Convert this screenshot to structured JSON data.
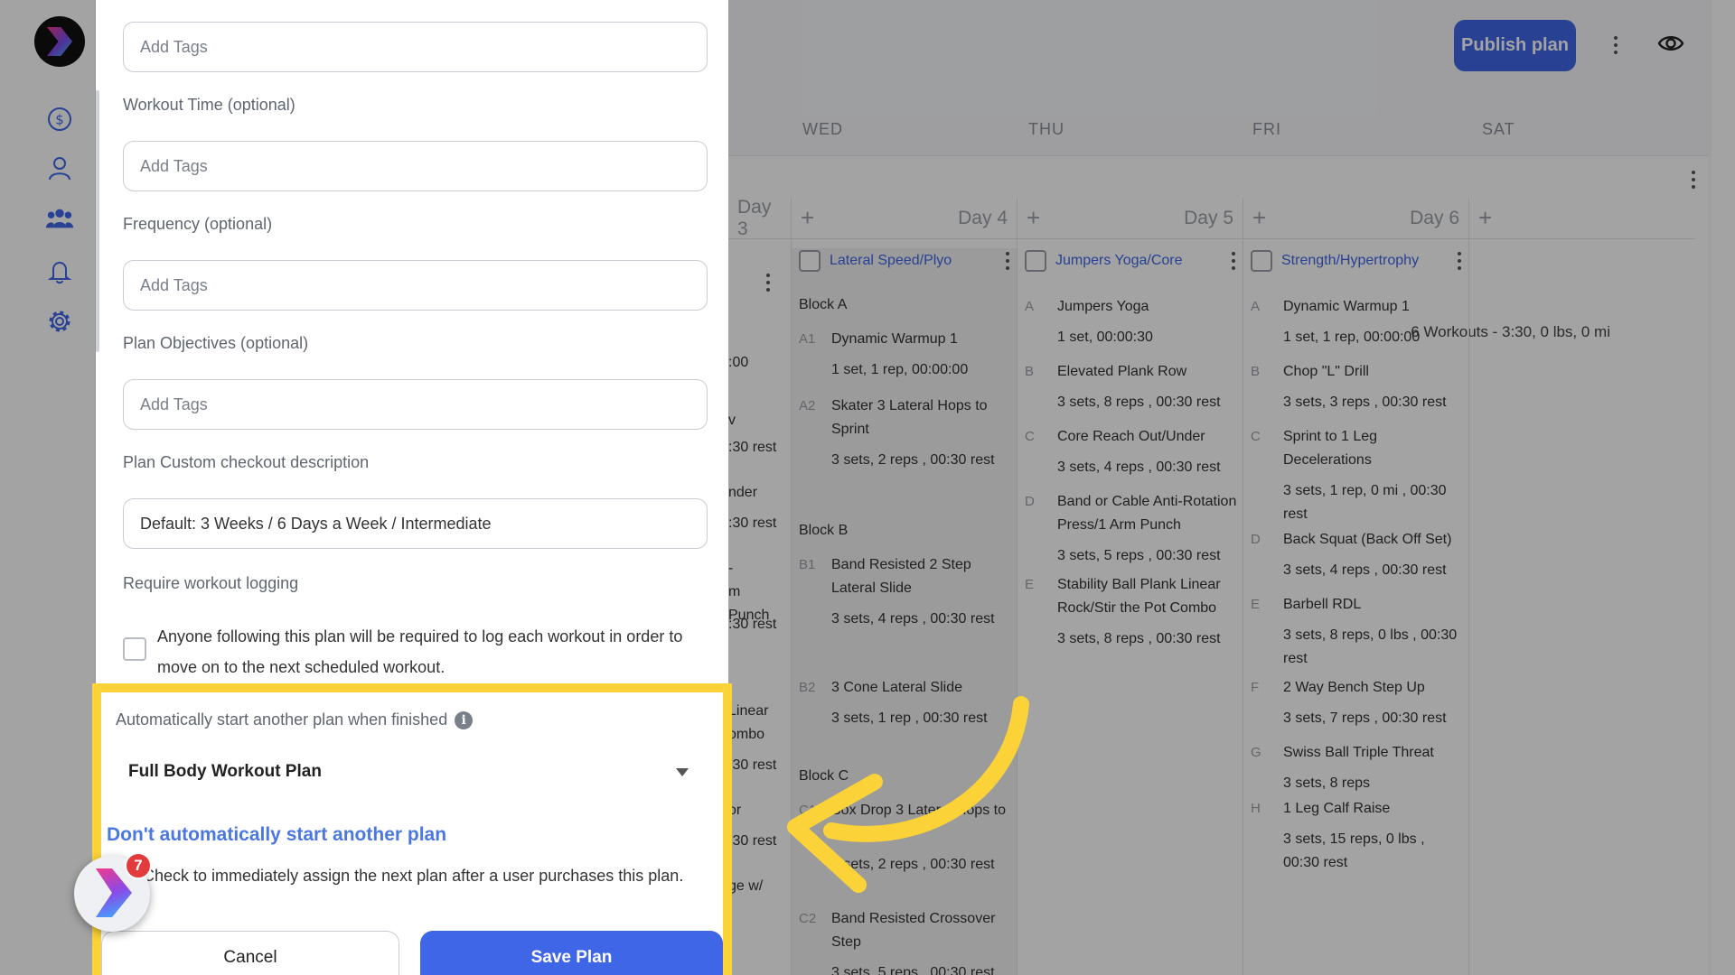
{
  "header": {
    "publish_label": "Publish plan"
  },
  "calendar": {
    "day_names": [
      "WED",
      "THU",
      "FRI",
      "SAT"
    ],
    "summary": "6 Workouts - 3:30, 0 lbs, 0 mi",
    "days": [
      {
        "label": "Day 4",
        "workout": "Lateral Speed/Plyo",
        "items": [
          {
            "type": "block",
            "text": "Block A"
          },
          {
            "code": "A1",
            "name": "Dynamic Warmup 1",
            "detail": "1 set, 1 rep, 00:00:00"
          },
          {
            "code": "A2",
            "name": "Skater 3 Lateral Hops to Sprint",
            "detail": "3 sets, 2 reps , 00:30 rest"
          },
          {
            "type": "block",
            "text": "Block B"
          },
          {
            "code": "B1",
            "name": "Band Resisted 2 Step Lateral Slide",
            "detail": "3 sets, 4 reps , 00:30 rest"
          },
          {
            "code": "B2",
            "name": "3 Cone Lateral Slide",
            "detail": "3 sets, 1 rep , 00:30 rest"
          },
          {
            "type": "block",
            "text": "Block C"
          },
          {
            "code": "C1",
            "name": "Box Drop 3 Lateral Hops to Slide",
            "detail": "3 sets, 2 reps , 00:30 rest"
          },
          {
            "code": "C2",
            "name": "Band Resisted Crossover Step",
            "detail": "3 sets, 5 reps , 00:30 rest"
          }
        ]
      },
      {
        "label": "Day 5",
        "workout": "Jumpers Yoga/Core",
        "items": [
          {
            "code": "A",
            "name": "Jumpers Yoga",
            "detail": "1 set, 00:00:30"
          },
          {
            "code": "B",
            "name": "Elevated Plank Row",
            "detail": "3 sets, 8 reps , 00:30 rest"
          },
          {
            "code": "C",
            "name": "Core Reach Out/Under",
            "detail": "3 sets, 4 reps , 00:30 rest"
          },
          {
            "code": "D",
            "name": "Band or Cable Anti-Rotation Press/1 Arm Punch",
            "detail": "3 sets, 5 reps , 00:30 rest"
          },
          {
            "code": "E",
            "name": "Stability Ball Plank Linear Rock/Stir the Pot Combo",
            "detail": "3 sets, 8 reps , 00:30 rest"
          }
        ]
      },
      {
        "label": "Day 6",
        "workout": "Strength/Hypertrophy",
        "items": [
          {
            "code": "A",
            "name": "Dynamic Warmup 1",
            "detail": "1 set, 1 rep, 00:00:00"
          },
          {
            "code": "B",
            "name": "Chop \"L\" Drill",
            "detail": "3 sets, 3 reps , 00:30 rest"
          },
          {
            "code": "C",
            "name": "Sprint to 1 Leg Decelerations",
            "detail": "3 sets, 1 rep, 0 mi , 00:30 rest"
          },
          {
            "code": "D",
            "name": "Back Squat (Back Off Set)",
            "detail": "3 sets, 4 reps , 00:30 rest"
          },
          {
            "code": "E",
            "name": "Barbell RDL",
            "detail": "3 sets, 8 reps, 0 lbs , 00:30 rest"
          },
          {
            "code": "F",
            "name": "2 Way Bench Step Up",
            "detail": "3 sets, 7 reps , 00:30 rest"
          },
          {
            "code": "G",
            "name": "Swiss Ball Triple Threat",
            "detail": "3 sets, 8 reps"
          },
          {
            "code": "H",
            "name": "1 Leg Calf Raise",
            "detail": "3 sets, 15 reps, 0 lbs , 00:30 rest"
          }
        ]
      }
    ],
    "day3_label": "Day 3",
    "day3_fragments": [
      ":00",
      "v",
      ":30 rest",
      "nder",
      ":30 rest",
      "-",
      "m Punch",
      ":30 rest",
      "Linear",
      "ombo",
      ":30 rest",
      "or",
      ":30 rest",
      "ge w/"
    ]
  },
  "form": {
    "tags_placeholder": "Add Tags",
    "workout_time_label": "Workout Time (optional)",
    "frequency_label": "Frequency (optional)",
    "objectives_label": "Plan Objectives (optional)",
    "checkout_label": "Plan Custom checkout description",
    "checkout_value": "Default: 3 Weeks / 6 Days a Week / Intermediate",
    "logging_label": "Require workout logging",
    "logging_text": "Anyone following this plan will be required to log each workout in order to move on to the next scheduled workout.",
    "auto_label": "Automatically start another plan when finished",
    "auto_selected": "Full Body Workout Plan",
    "dont_auto_link": "Don't automatically start another plan",
    "assign_text": "Check to immediately assign the next plan after a user purchases this plan.",
    "cancel_label": "Cancel",
    "save_label": "Save Plan"
  },
  "widget": {
    "badge_count": "7"
  },
  "colors": {
    "accent": "#3f66e6",
    "highlight": "#fbd238",
    "link": "#4a78e0"
  }
}
